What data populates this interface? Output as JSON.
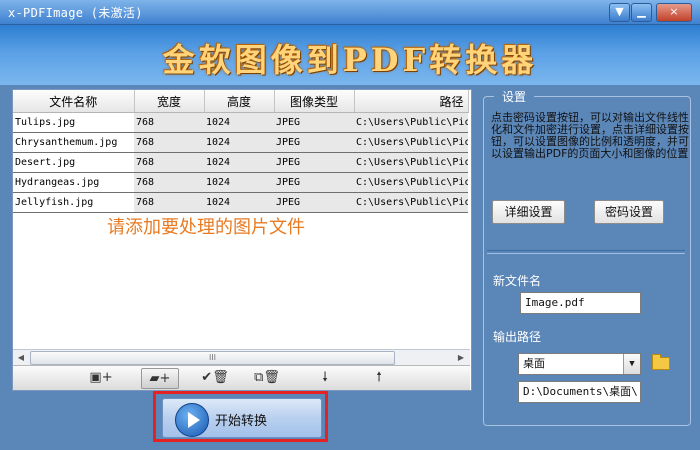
{
  "window": {
    "title": "x-PDFImage (未激活)",
    "controls": {
      "minimize": "▼",
      "close": "×"
    }
  },
  "banner": {
    "title": "金软图像到PDF转换器"
  },
  "file_table": {
    "columns": [
      "文件名称",
      "宽度",
      "高度",
      "图像类型",
      "路径"
    ],
    "rows": [
      [
        "Tulips.jpg",
        "768",
        "1024",
        "JPEG",
        "C:\\Users\\Public\\Pic"
      ],
      [
        "Chrysanthemum.jpg",
        "768",
        "1024",
        "JPEG",
        "C:\\Users\\Public\\Pic"
      ],
      [
        "Desert.jpg",
        "768",
        "1024",
        "JPEG",
        "C:\\Users\\Public\\Pic"
      ],
      [
        "Hydrangeas.jpg",
        "768",
        "1024",
        "JPEG",
        "C:\\Users\\Public\\Pic"
      ],
      [
        "Jellyfish.jpg",
        "768",
        "1024",
        "JPEG",
        "C:\\Users\\Public\\Pic"
      ]
    ],
    "hint": "请添加要处理的图片文件"
  },
  "scroll": {
    "thumb_grip": "III"
  },
  "toolbar": {
    "buttons": [
      {
        "icon": "add-file-icon",
        "glyph": "▣+"
      },
      {
        "icon": "add-folder-icon",
        "glyph": "▰+"
      },
      {
        "icon": "remove-selected-icon",
        "glyph": "✔🗑"
      },
      {
        "icon": "remove-all-icon",
        "glyph": "⧉🗑"
      },
      {
        "icon": "move-down-icon",
        "glyph": "🠗"
      },
      {
        "icon": "move-up-icon",
        "glyph": "🠕"
      }
    ]
  },
  "start_button": {
    "label": "开始转换"
  },
  "settings": {
    "legend": "设置",
    "description": "点击密码设置按钮，可以对输出文件线性化和文件加密进行设置，点击详细设置按钮，可以设置图像的比例和透明度，并可以设置输出PDF的页面大小和图像的位置",
    "detail_button": "详细设置",
    "password_button": "密码设置",
    "new_filename_label": "新文件名",
    "new_filename_value": "Image.pdf",
    "output_path_label": "输出路径",
    "output_path_option": "桌面",
    "output_path_value": "D:\\Documents\\桌面\\"
  }
}
